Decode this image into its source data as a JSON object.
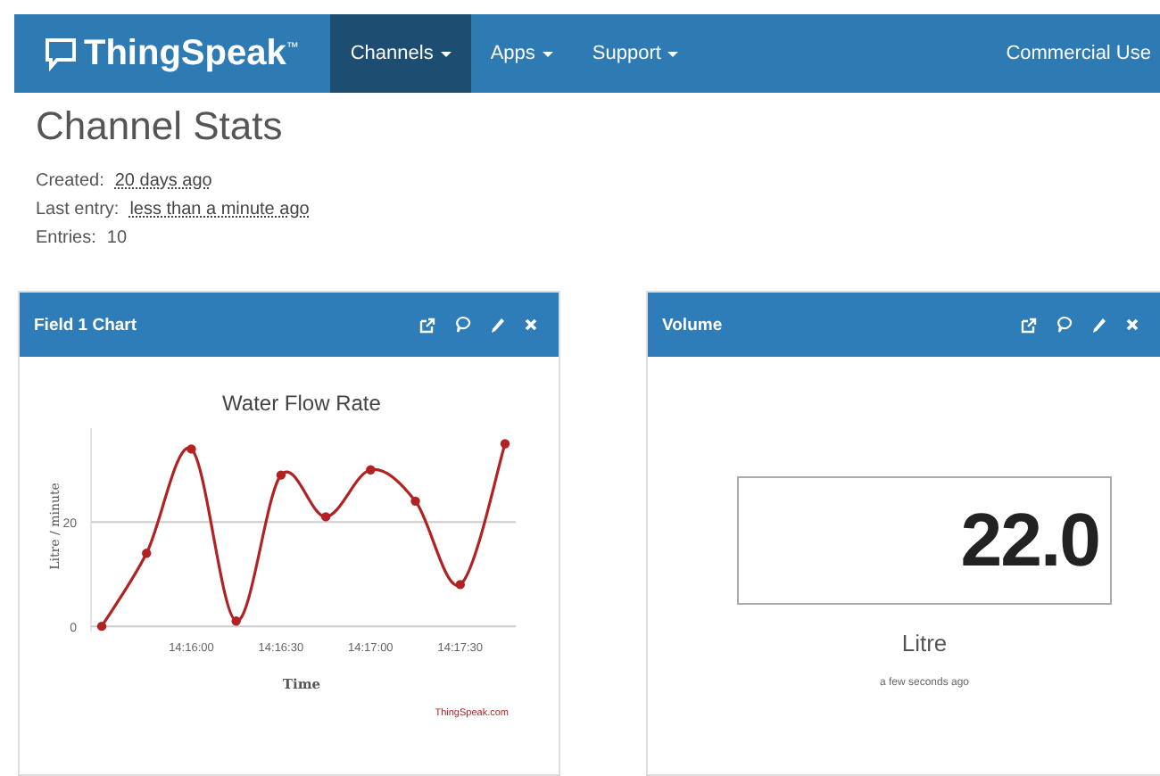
{
  "navbar": {
    "logo": "ThingSpeak$^{™}$",
    "menus": [
      {
        "label": "Channels",
        "selected": true
      },
      {
        "label": "Apps",
        "selected": false
      },
      {
        "label": "Support",
        "selected": false
      }
    ],
    "right_link": "Commercial Use"
  },
  "page_title": "Channel Stats",
  "stats": [
    {
      "label": "Created:",
      "value": "20 days ago"
    },
    {
      "label": "Last entry:",
      "value": "less than a minute ago"
    },
    {
      "label": "Entries:",
      "value": "10"
    }
  ],
  "cards": [
    {
      "kind": "chart",
      "title": "Field 1 Chart",
      "chart_data": {
        "type": "line",
        "title": "Water Flow Rate",
        "xlabel": "Time",
        "ylabel": "Litre / minute",
        "categories": [
          null,
          null,
          "14:16:00",
          null,
          "14:16:30",
          null,
          "14:17:00",
          null,
          "14:17:30",
          null
        ],
        "series": [
          {
            "color": "#b22222",
            "marker": "circle",
            "values": [
              0,
              14,
              34,
              1,
              29,
              21,
              30,
              24,
              8,
              35
            ]
          }
        ],
        "ylim": [
          -1,
          38
        ],
        "yticks": [
          0,
          20
        ]
      },
      "credit": "ThingSpeak.com"
    },
    {
      "kind": "numeric",
      "title": "Volume",
      "value": "22.0",
      "unit": "Litre",
      "updated": "a few seconds ago"
    }
  ]
}
